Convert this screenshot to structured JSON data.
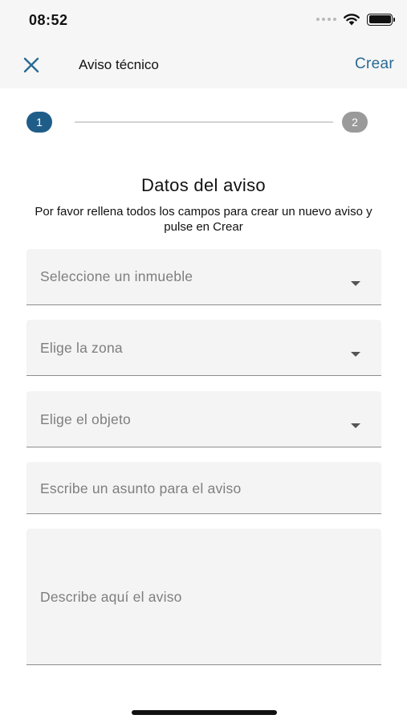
{
  "status_bar": {
    "time": "08:52",
    "icons": [
      "signal-dots-icon",
      "wifi-icon",
      "battery-icon"
    ]
  },
  "nav": {
    "close_icon": "close-icon",
    "title": "Aviso técnico",
    "create_label": "Crear",
    "accent_color": "#2a6a94"
  },
  "stepper": {
    "steps": [
      {
        "label": "1",
        "state": "active",
        "color": "#1f5d89"
      },
      {
        "label": "2",
        "state": "inactive",
        "color": "#9a9a9a"
      }
    ]
  },
  "form": {
    "title": "Datos del aviso",
    "subtitle": "Por favor rellena todos los campos para crear un nuevo aviso y pulse en Crear",
    "fields": {
      "inmueble": {
        "placeholder": "Seleccione un inmueble",
        "type": "select"
      },
      "zona": {
        "placeholder": "Elige la zona",
        "type": "select"
      },
      "objeto": {
        "placeholder": "Elige el objeto",
        "type": "select"
      },
      "asunto": {
        "placeholder": "Escribe un asunto para el aviso",
        "type": "text"
      },
      "descripcion": {
        "placeholder": "Describe aquí el aviso",
        "type": "textarea"
      }
    }
  }
}
